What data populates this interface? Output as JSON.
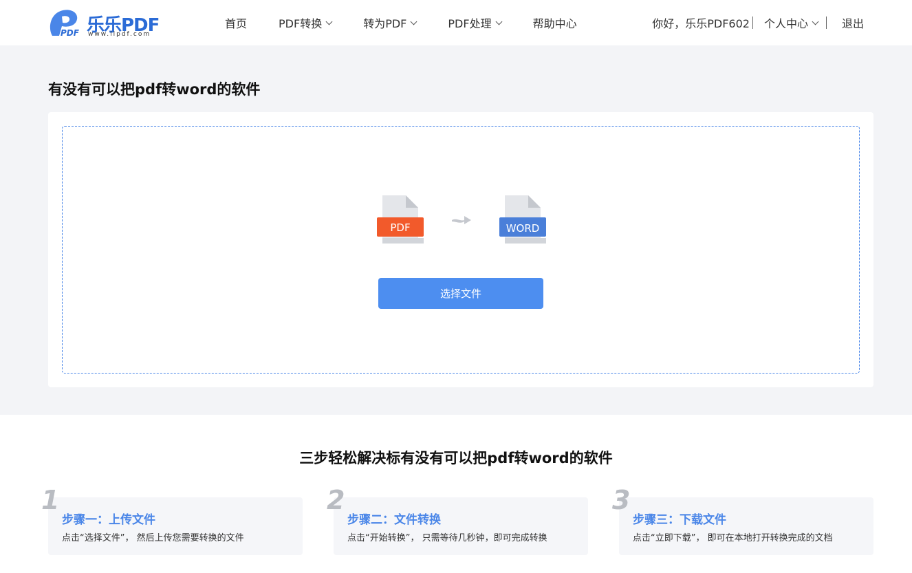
{
  "header": {
    "logo_text": "乐乐PDF",
    "logo_url": "www.llpdf.com",
    "nav": [
      {
        "label": "首页",
        "has_dropdown": false
      },
      {
        "label": "PDF转换",
        "has_dropdown": true
      },
      {
        "label": "转为PDF",
        "has_dropdown": true
      },
      {
        "label": "PDF处理",
        "has_dropdown": true
      },
      {
        "label": "帮助中心",
        "has_dropdown": false
      }
    ],
    "greeting": "你好，乐乐PDF602",
    "user_center": "个人中心",
    "logout": "退出"
  },
  "main": {
    "title": "有没有可以把pdf转word的软件",
    "source_format": "PDF",
    "target_format": "WORD",
    "select_button": "选择文件"
  },
  "steps": {
    "title": "三步轻松解决标有没有可以把pdf转word的软件",
    "items": [
      {
        "num": "1",
        "head": "步骤一：上传文件",
        "desc": "点击“选择文件”， 然后上传您需要转换的文件"
      },
      {
        "num": "2",
        "head": "步骤二：文件转换",
        "desc": "点击“开始转换”， 只需等待几秒钟，即可完成转换"
      },
      {
        "num": "3",
        "head": "步骤三：下载文件",
        "desc": "点击“立即下载”， 即可在本地打开转换完成的文档"
      }
    ]
  },
  "colors": {
    "accent": "#4d8ef0",
    "pdf_red": "#f25a2b",
    "word_blue": "#4a7fd9",
    "page_bg": "#f3f4f7"
  }
}
